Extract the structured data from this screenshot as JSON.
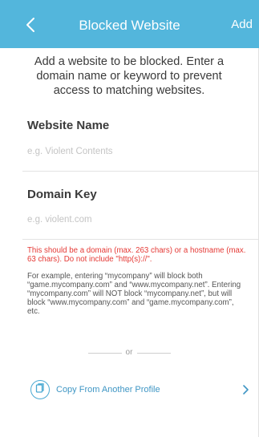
{
  "navbar": {
    "title": "Blocked Website",
    "add_label": "Add"
  },
  "intro": {
    "text": "Add a website to be blocked. Enter a domain name or keyword to prevent access to matching websites."
  },
  "website_name": {
    "label": "Website Name",
    "placeholder": "e.g. Violent Contents",
    "value": ""
  },
  "domain_key": {
    "label": "Domain Key",
    "placeholder": "e.g. violent.com",
    "value": ""
  },
  "hints": {
    "error": "This should be a domain (max. 263 chars) or a hostname (max. 63 chars). Do not include \"http(s)://\".",
    "example": "For example, entering “mycompany” will block both “game.mycompany.com” and “www.mycompany.net”. Entering “mycompany.com” will NOT block “mycompany.net”, but will block “www.mycompany.com” and “game.mycompany.com”, etc."
  },
  "separator": {
    "text": "or"
  },
  "copy_profile": {
    "label": "Copy From Another Profile"
  },
  "colors": {
    "accent": "#53b6dc",
    "error": "#e53935",
    "link": "#3f96c4"
  },
  "icons": {
    "back": "chevron-left-icon",
    "copy": "copy-icon",
    "chevron": "chevron-right-icon"
  }
}
